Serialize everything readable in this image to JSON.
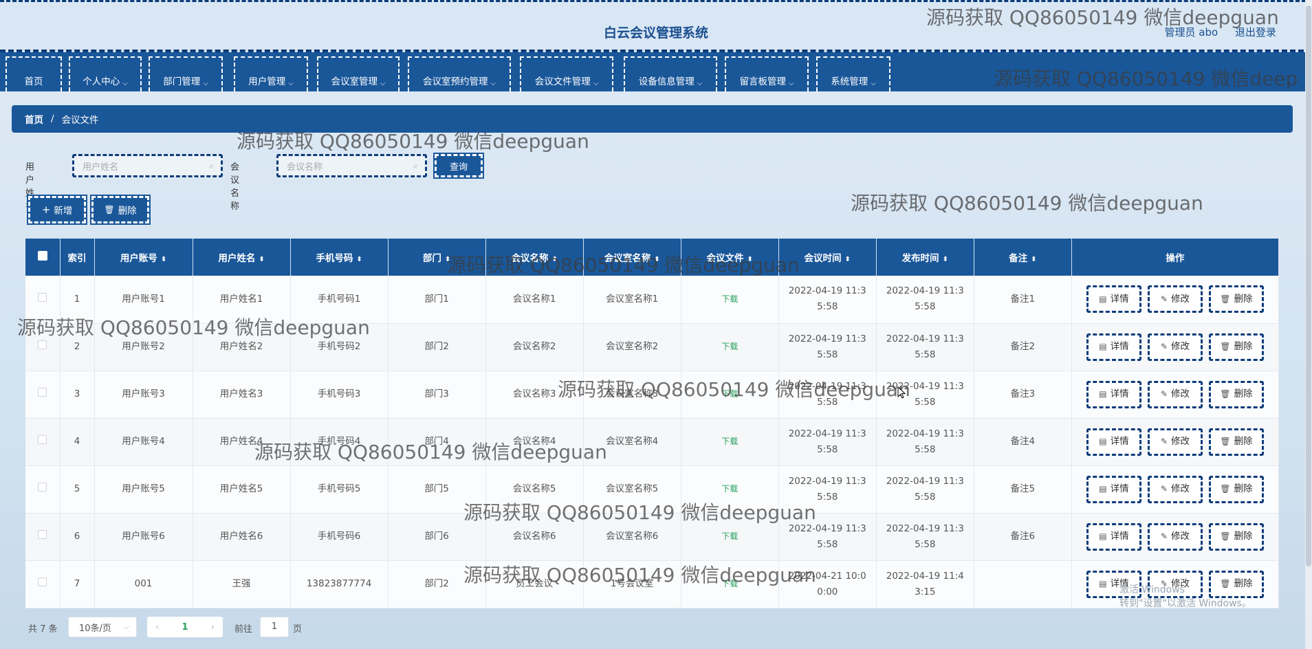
{
  "header": {
    "title": "白云会议管理系统",
    "role": "管理员 abo",
    "logout": "退出登录"
  },
  "nav": {
    "items": [
      {
        "label": "首页",
        "dropdown": false
      },
      {
        "label": "个人中心",
        "dropdown": true
      },
      {
        "label": "部门管理",
        "dropdown": true
      },
      {
        "label": "用户管理",
        "dropdown": true
      },
      {
        "label": "会议室管理",
        "dropdown": true
      },
      {
        "label": "会议室预约管理",
        "dropdown": true
      },
      {
        "label": "会议文件管理",
        "dropdown": true
      },
      {
        "label": "设备信息管理",
        "dropdown": true
      },
      {
        "label": "留言板管理",
        "dropdown": true
      },
      {
        "label": "系统管理",
        "dropdown": true
      }
    ]
  },
  "breadcrumb": {
    "home": "首页",
    "separator": "/",
    "current": "会议文件"
  },
  "search": {
    "user_label": "用户姓名",
    "user_placeholder": "用户姓名",
    "meeting_label": "会议名称",
    "meeting_placeholder": "会议名称",
    "query_button": "查询"
  },
  "actions": {
    "add": "新增",
    "delete": "删除"
  },
  "table": {
    "columns": [
      "索引",
      "用户账号",
      "用户姓名",
      "手机号码",
      "部门",
      "会议名称",
      "会议室名称",
      "会议文件",
      "会议时间",
      "发布时间",
      "备注",
      "操作"
    ],
    "rows": [
      {
        "index": "1",
        "account": "用户账号1",
        "name": "用户姓名1",
        "phone": "手机号码1",
        "dept": "部门1",
        "meeting": "会议名称1",
        "room": "会议室名称1",
        "file": "下载",
        "meet_time_a": "2022-04-19 11:3",
        "meet_time_b": "5:58",
        "pub_time_a": "2022-04-19 11:3",
        "pub_time_b": "5:58",
        "remark": "备注1"
      },
      {
        "index": "2",
        "account": "用户账号2",
        "name": "用户姓名2",
        "phone": "手机号码2",
        "dept": "部门2",
        "meeting": "会议名称2",
        "room": "会议室名称2",
        "file": "下载",
        "meet_time_a": "2022-04-19 11:3",
        "meet_time_b": "5:58",
        "pub_time_a": "2022-04-19 11:3",
        "pub_time_b": "5:58",
        "remark": "备注2"
      },
      {
        "index": "3",
        "account": "用户账号3",
        "name": "用户姓名3",
        "phone": "手机号码3",
        "dept": "部门3",
        "meeting": "会议名称3",
        "room": "会议室名称3",
        "file": "下载",
        "meet_time_a": "2022-04-19 11:3",
        "meet_time_b": "5:58",
        "pub_time_a": "2022-04-19 11:3",
        "pub_time_b": "5:58",
        "remark": "备注3"
      },
      {
        "index": "4",
        "account": "用户账号4",
        "name": "用户姓名4",
        "phone": "手机号码4",
        "dept": "部门4",
        "meeting": "会议名称4",
        "room": "会议室名称4",
        "file": "下载",
        "meet_time_a": "2022-04-19 11:3",
        "meet_time_b": "5:58",
        "pub_time_a": "2022-04-19 11:3",
        "pub_time_b": "5:58",
        "remark": "备注4"
      },
      {
        "index": "5",
        "account": "用户账号5",
        "name": "用户姓名5",
        "phone": "手机号码5",
        "dept": "部门5",
        "meeting": "会议名称5",
        "room": "会议室名称5",
        "file": "下载",
        "meet_time_a": "2022-04-19 11:3",
        "meet_time_b": "5:58",
        "pub_time_a": "2022-04-19 11:3",
        "pub_time_b": "5:58",
        "remark": "备注5"
      },
      {
        "index": "6",
        "account": "用户账号6",
        "name": "用户姓名6",
        "phone": "手机号码6",
        "dept": "部门6",
        "meeting": "会议名称6",
        "room": "会议室名称6",
        "file": "下载",
        "meet_time_a": "2022-04-19 11:3",
        "meet_time_b": "5:58",
        "pub_time_a": "2022-04-19 11:3",
        "pub_time_b": "5:58",
        "remark": "备注6"
      },
      {
        "index": "7",
        "account": "001",
        "name": "王强",
        "phone": "13823877774",
        "dept": "部门2",
        "meeting": "员工会议",
        "room": "1号会议室",
        "file": "下载",
        "meet_time_a": "2022-04-21 10:0",
        "meet_time_b": "0:00",
        "pub_time_a": "2022-04-19 11:4",
        "pub_time_b": "3:15",
        "remark": ""
      }
    ],
    "row_actions": {
      "detail": "详情",
      "edit": "修改",
      "delete": "删除"
    }
  },
  "pagination": {
    "total": "共 7 条",
    "page_size": "10条/页",
    "current_page": "1",
    "goto_label": "前往",
    "goto_value": "1",
    "goto_unit": "页"
  },
  "watermarks": [
    "源码获取 QQ86050149 微信deepguan",
    "源码获取 QQ86050149 微信deep"
  ],
  "windows_activation": {
    "line1": "激活 Windows",
    "line2": "转到\"设置\"以激活 Windows。"
  },
  "colors": {
    "primary": "#1a5799",
    "border_dash": "#0c3c7a",
    "download": "#2aa15d"
  }
}
